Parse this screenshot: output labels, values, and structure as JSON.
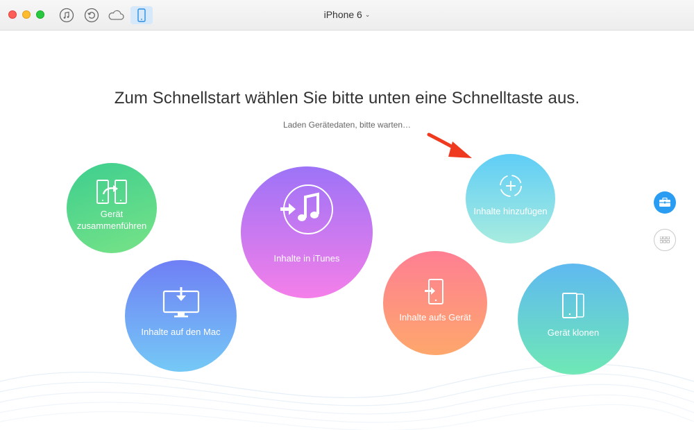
{
  "titlebar": {
    "device_name": "iPhone 6",
    "toolbar_icons": [
      "music-icon",
      "history-icon",
      "cloud-icon",
      "phone-icon"
    ]
  },
  "main": {
    "headline": "Zum Schnellstart wählen Sie bitte unten eine Schnelltaste aus.",
    "status": "Laden Gerätedaten, bitte warten…"
  },
  "actions": {
    "merge": {
      "label_line1": "Gerät",
      "label_line2": "zusammenführen",
      "icon": "merge-devices-icon"
    },
    "to_mac": {
      "label": "Inhalte auf den Mac",
      "icon": "monitor-download-icon"
    },
    "itunes": {
      "label": "Inhalte in iTunes",
      "icon": "itunes-icon"
    },
    "add": {
      "label": "Inhalte hinzufügen",
      "icon": "add-content-icon"
    },
    "to_device": {
      "label": "Inhalte aufs Gerät",
      "icon": "device-import-icon"
    },
    "clone": {
      "label": "Gerät klonen",
      "icon": "clone-device-icon"
    }
  },
  "side": {
    "icons": [
      "toolbox-icon",
      "grid-icon"
    ]
  },
  "colors": {
    "accent": "#2a9cf2",
    "arrow": "#f03a1f",
    "merge": "#3dce8f",
    "to_mac": "#6f7ff5",
    "itunes": "#9d73f7",
    "add": "#5fcdf6",
    "to_device": "#fe7f93",
    "clone": "#5fb9f1"
  }
}
